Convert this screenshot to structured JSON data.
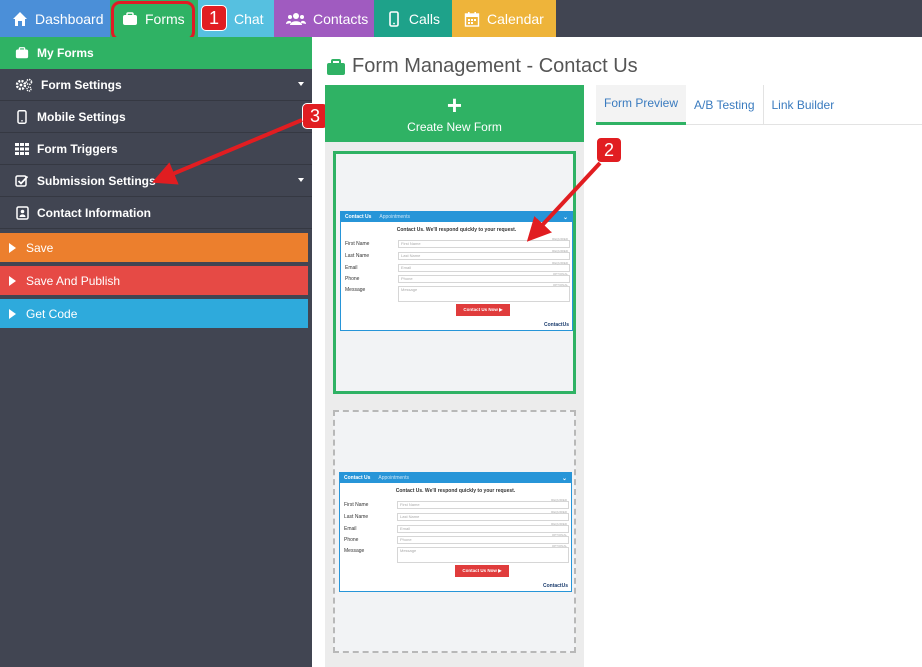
{
  "topnav": {
    "dashboard": "Dashboard",
    "forms": "Forms",
    "chat": "Chat",
    "contacts": "Contacts",
    "calls": "Calls",
    "calendar": "Calendar"
  },
  "sidebar": {
    "items": [
      {
        "label": "My Forms",
        "icon": "briefcase-icon"
      },
      {
        "label": "Form Settings",
        "icon": "gears-icon"
      },
      {
        "label": "Mobile Settings",
        "icon": "mobile-icon"
      },
      {
        "label": "Form Triggers",
        "icon": "grid-icon"
      },
      {
        "label": "Submission Settings",
        "icon": "checkbox-icon"
      },
      {
        "label": "Contact Information",
        "icon": "contact-card-icon"
      }
    ],
    "buttons": {
      "save": "Save",
      "publish": "Save And Publish",
      "code": "Get Code"
    }
  },
  "main": {
    "title": "Form Management - Contact Us",
    "create_plus": "+",
    "create_label": "Create New Form",
    "tabs": [
      "Form Preview",
      "A/B Testing",
      "Link Builder"
    ]
  },
  "preview": {
    "tab1": "Contact Us",
    "tab2": "Appointments",
    "chev": "⌄",
    "intro": "Contact Us. We'll respond quickly to your request.",
    "fields": [
      {
        "label": "First Name",
        "placeholder": "First Name",
        "req": "REQUIRED"
      },
      {
        "label": "Last Name",
        "placeholder": "Last Name",
        "req": "REQUIRED"
      },
      {
        "label": "Email",
        "placeholder": "Email",
        "req": "REQUIRED"
      },
      {
        "label": "Phone",
        "placeholder": "Phone",
        "req": "OPTIONAL"
      },
      {
        "label": "Message",
        "placeholder": "Message",
        "req": "OPTIONAL"
      }
    ],
    "submit": "Contact Us Now ▶",
    "logo": "ContactUs"
  },
  "annotations": {
    "badge1": "1",
    "badge2": "2",
    "badge3": "3"
  },
  "colors": {
    "nav_bg": "#414552",
    "green": "#2fb264",
    "orange": "#ec7f2d",
    "red": "#e64a45",
    "blue": "#2eaadc",
    "annotation_red": "#e11d21"
  }
}
